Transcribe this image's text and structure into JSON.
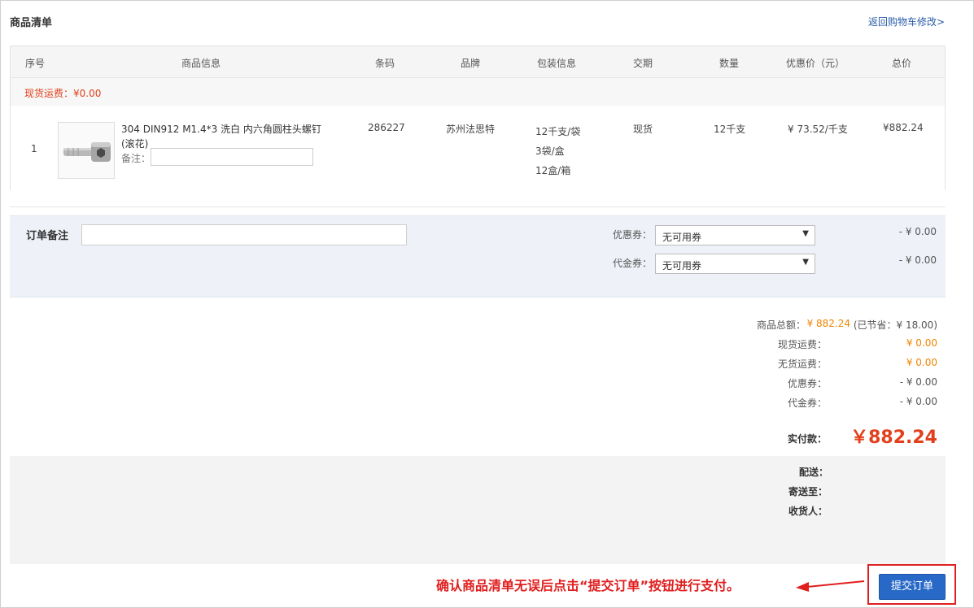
{
  "header": {
    "title": "商品清单",
    "back_link": "返回购物车修改>"
  },
  "table": {
    "columns": [
      "序号",
      "商品信息",
      "条码",
      "品牌",
      "包装信息",
      "交期",
      "数量",
      "优惠价（元）",
      "总价"
    ],
    "shipping_fee": "现货运费：¥0.00",
    "rows": [
      {
        "index": "1",
        "product_name": "304  DIN912  M1.4*3    洗白  内六角圆柱头螺钉(滚花)",
        "note_label": "备注：",
        "note_value": "",
        "barcode": "286227",
        "brand": "苏州法思特",
        "packaging": [
          "12千支/袋",
          "3袋/盒",
          "12盒/箱"
        ],
        "delivery": "现货",
        "quantity": "12千支",
        "unit_price": "¥ 73.52/千支",
        "total": "¥882.24"
      }
    ]
  },
  "order_panel": {
    "note_label": "订单备注",
    "note_value": "",
    "coupon_label": "优惠券：",
    "coupon_selected": "无可用券",
    "coupon_amount": "- ¥ 0.00",
    "voucher_label": "代金券：",
    "voucher_selected": "无可用券",
    "voucher_amount": "- ¥ 0.00"
  },
  "summary": {
    "goods_total_label": "商品总额：",
    "goods_total_value": "¥ 882.24",
    "saved_text": "(已节省：¥ 18.00)",
    "spot_freight_label": "现货运费：",
    "spot_freight_value": "¥ 0.00",
    "nostock_freight_label": "无货运费：",
    "nostock_freight_value": "¥ 0.00",
    "coupon_label": "优惠券：",
    "coupon_value": "- ¥ 0.00",
    "voucher_label": "代金券：",
    "voucher_value": "- ¥ 0.00",
    "paid_label": "实付款：",
    "paid_value": "￥882.24"
  },
  "delivery": {
    "shipping_label": "配送：",
    "ship_to_label": "寄送至：",
    "receiver_label": "收货人："
  },
  "footer": {
    "instruction": "确认商品清单无误后点击“提交订单”按钮进行支付。",
    "submit_label": "提交订单"
  },
  "colors": {
    "accent_red": "#e2401c",
    "price_orange": "#f08300",
    "link_blue": "#2a5ca8",
    "button_blue": "#2869c7"
  }
}
